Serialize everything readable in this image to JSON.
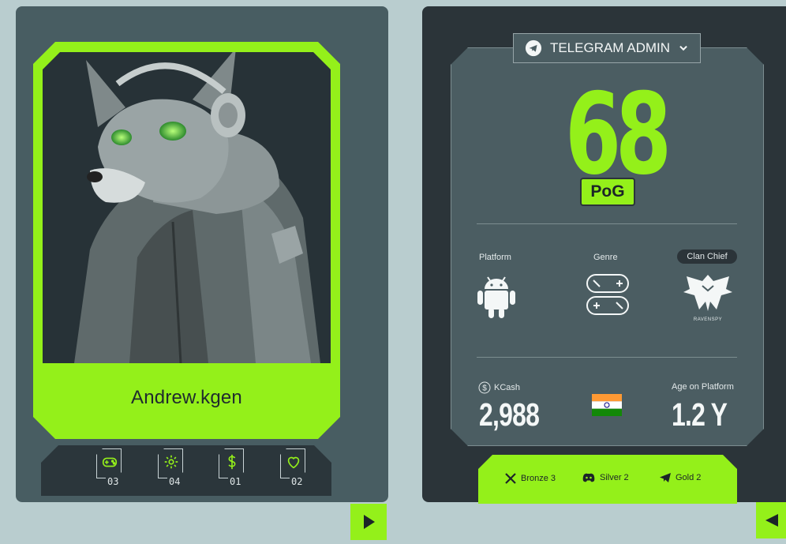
{
  "player": {
    "name": "Andrew.kgen"
  },
  "stats": [
    {
      "icon": "gamepad-icon",
      "value": "03"
    },
    {
      "icon": "gear-icon",
      "value": "04"
    },
    {
      "icon": "dollar-icon",
      "value": "01"
    },
    {
      "icon": "heart-icon",
      "value": "02"
    }
  ],
  "role": {
    "label": "TELEGRAM ADMIN"
  },
  "score": {
    "value": "68",
    "label": "PoG"
  },
  "attributes": {
    "platform_label": "Platform",
    "genre_label": "Genre",
    "clan_label": "Clan Chief",
    "clan_name": "RAVENSPY"
  },
  "kcash": {
    "label": "KCash",
    "value": "2,988"
  },
  "age": {
    "label": "Age on Platform",
    "value": "1.2 Y"
  },
  "badges": [
    {
      "icon": "x-icon",
      "label": "Bronze 3"
    },
    {
      "icon": "discord-icon",
      "label": "Silver 2"
    },
    {
      "icon": "telegram-icon",
      "label": "Gold 2"
    }
  ],
  "colors": {
    "accent": "#94f01a",
    "panel": "#485d62",
    "dark": "#2b3439",
    "background": "#b9cdcf"
  }
}
